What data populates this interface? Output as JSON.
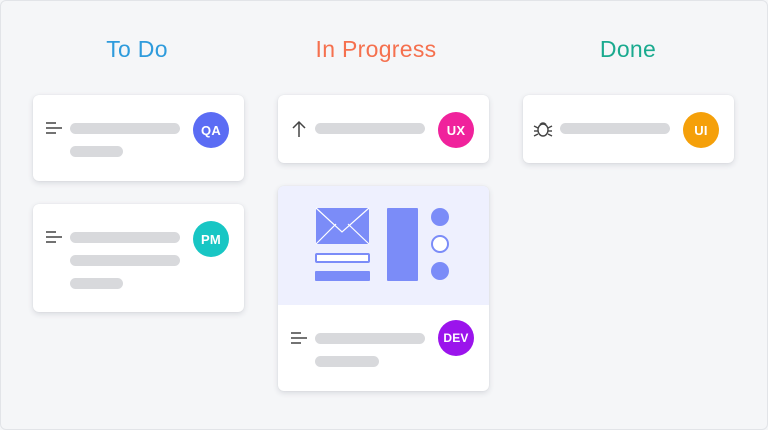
{
  "board": {
    "columns": [
      {
        "title": "To Do",
        "color": "#2e9bdc"
      },
      {
        "title": "In Progress",
        "color": "#f5704e"
      },
      {
        "title": "Done",
        "color": "#1aaa8f"
      }
    ]
  },
  "cards": {
    "todo_1": {
      "avatar": "QA",
      "avatar_color": "#5b6cf4",
      "icon": "lines-icon"
    },
    "todo_2": {
      "avatar": "PM",
      "avatar_color": "#18c6c4",
      "icon": "lines-icon"
    },
    "progress_1": {
      "avatar": "UX",
      "avatar_color": "#f0229c",
      "icon": "arrow-up-icon"
    },
    "progress_2": {
      "avatar": "DEV",
      "avatar_color": "#9b14ec",
      "icon": "lines-icon"
    },
    "done_1": {
      "avatar": "UI",
      "avatar_color": "#f5a00a",
      "icon": "bug-icon"
    }
  },
  "colors": {
    "wireframe": "#7b8cf8",
    "placeholder": "#d8d9dc",
    "preview_bg": "#eef0fe"
  }
}
